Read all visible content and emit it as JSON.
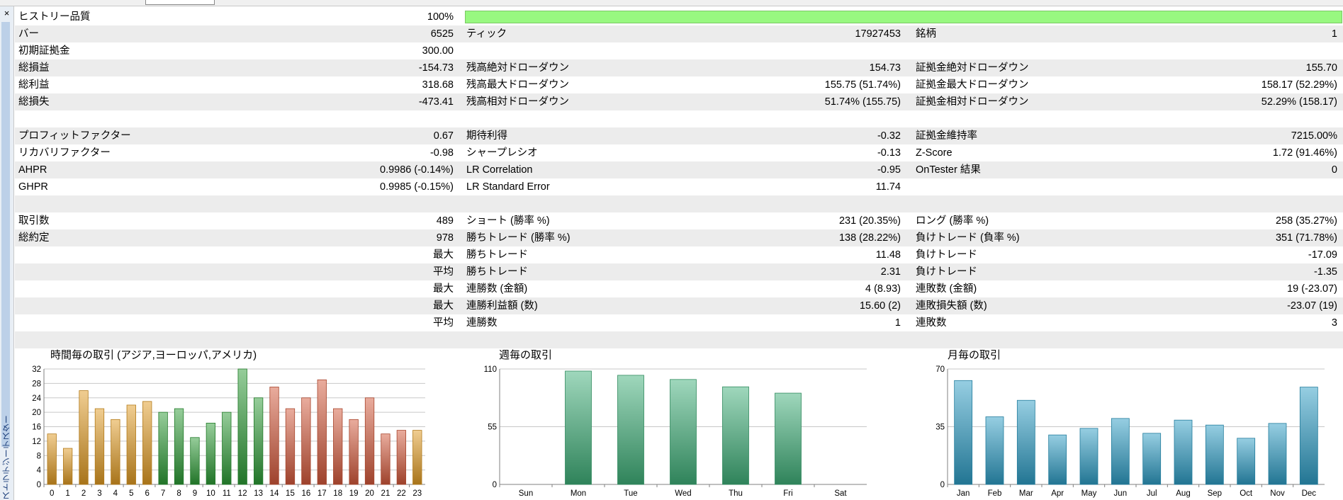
{
  "top_tabs": [
    "",
    "",
    ""
  ],
  "sidebar": {
    "close_glyph": "×",
    "title": "ストラテジーテスター"
  },
  "report": {
    "rows": [
      {
        "l1": "ヒストリー品質",
        "v1": "100%",
        "l2": "",
        "v2": "",
        "l3": "",
        "v3": "",
        "quality_fraction": 1.0,
        "shade": false
      },
      {
        "l1": "バー",
        "v1": "6525",
        "l2": "ティック",
        "v2": "17927453",
        "l3": "銘柄",
        "v3": "1",
        "shade": true
      },
      {
        "l1": "初期証拠金",
        "v1": "300.00",
        "l2": "",
        "v2": "",
        "l3": "",
        "v3": "",
        "shade": false
      },
      {
        "l1": "総損益",
        "v1": "-154.73",
        "l2": "残高絶対ドローダウン",
        "v2": "154.73",
        "l3": "証拠金絶対ドローダウン",
        "v3": "155.70",
        "shade": true
      },
      {
        "l1": "総利益",
        "v1": "318.68",
        "l2": "残高最大ドローダウン",
        "v2": "155.75 (51.74%)",
        "l3": "証拠金最大ドローダウン",
        "v3": "158.17 (52.29%)",
        "shade": false
      },
      {
        "l1": "総損失",
        "v1": "-473.41",
        "l2": "残高相対ドローダウン",
        "v2": "51.74% (155.75)",
        "l3": "証拠金相対ドローダウン",
        "v3": "52.29% (158.17)",
        "shade": true
      },
      {
        "l1": "",
        "v1": "",
        "l2": "",
        "v2": "",
        "l3": "",
        "v3": "",
        "shade": false
      },
      {
        "l1": "プロフィットファクター",
        "v1": "0.67",
        "l2": "期待利得",
        "v2": "-0.32",
        "l3": "証拠金維持率",
        "v3": "7215.00%",
        "shade": true
      },
      {
        "l1": "リカバリファクター",
        "v1": "-0.98",
        "l2": "シャープレシオ",
        "v2": "-0.13",
        "l3": "Z-Score",
        "v3": "1.72 (91.46%)",
        "shade": false
      },
      {
        "l1": "AHPR",
        "v1": "0.9986 (-0.14%)",
        "l2": "LR Correlation",
        "v2": "-0.95",
        "l3": "OnTester 結果",
        "v3": "0",
        "shade": true
      },
      {
        "l1": "GHPR",
        "v1": "0.9985 (-0.15%)",
        "l2": "LR Standard Error",
        "v2": "11.74",
        "l3": "",
        "v3": "",
        "shade": false
      },
      {
        "l1": "",
        "v1": "",
        "l2": "",
        "v2": "",
        "l3": "",
        "v3": "",
        "shade": true
      },
      {
        "l1": "取引数",
        "v1": "489",
        "l2": "ショート (勝率 %)",
        "v2": "231 (20.35%)",
        "l3": "ロング (勝率 %)",
        "v3": "258 (35.27%)",
        "shade": false
      },
      {
        "l1": "総約定",
        "v1": "978",
        "l2": "勝ちトレード (勝率 %)",
        "v2": "138 (28.22%)",
        "l3": "負けトレード (負率 %)",
        "v3": "351 (71.78%)",
        "shade": true
      },
      {
        "l1": "",
        "v1": "最大",
        "l2": "勝ちトレード",
        "v2": "11.48",
        "l3": "負けトレード",
        "v3": "-17.09",
        "shade": false
      },
      {
        "l1": "",
        "v1": "平均",
        "l2": "勝ちトレード",
        "v2": "2.31",
        "l3": "負けトレード",
        "v3": "-1.35",
        "shade": true
      },
      {
        "l1": "",
        "v1": "最大",
        "l2": "連勝数 (金額)",
        "v2": "4 (8.93)",
        "l3": "連敗数 (金額)",
        "v3": "19 (-23.07)",
        "shade": false
      },
      {
        "l1": "",
        "v1": "最大",
        "l2": "連勝利益額 (数)",
        "v2": "15.60 (2)",
        "l3": "連敗損失額 (数)",
        "v3": "-23.07 (19)",
        "shade": true
      },
      {
        "l1": "",
        "v1": "平均",
        "l2": "連勝数",
        "v2": "1",
        "l3": "連敗数",
        "v3": "3",
        "shade": false
      },
      {
        "l1": "",
        "v1": "",
        "l2": "",
        "v2": "",
        "l3": "",
        "v3": "",
        "shade": true
      }
    ]
  },
  "chart_data": [
    {
      "type": "bar",
      "title": "時間毎の取引 (アジア,ヨーロッパ,アメリカ)",
      "categories": [
        "0",
        "1",
        "2",
        "3",
        "4",
        "5",
        "6",
        "7",
        "8",
        "9",
        "10",
        "11",
        "12",
        "13",
        "14",
        "15",
        "16",
        "17",
        "18",
        "19",
        "20",
        "21",
        "22",
        "23"
      ],
      "values": [
        14,
        10,
        26,
        21,
        18,
        22,
        23,
        20,
        21,
        13,
        17,
        20,
        32,
        24,
        27,
        21,
        24,
        29,
        21,
        18,
        24,
        14,
        15,
        15
      ],
      "session_by_category": [
        "asia",
        "asia",
        "asia",
        "asia",
        "asia",
        "asia",
        "asia",
        "europe",
        "europe",
        "europe",
        "europe",
        "europe",
        "europe",
        "europe",
        "america",
        "america",
        "america",
        "america",
        "america",
        "america",
        "america",
        "america",
        "america",
        "asia"
      ],
      "colors": {
        "asia": "#e09a22",
        "europe": "#2c9a35",
        "america": "#d2583a"
      },
      "yticks": [
        0,
        4,
        8,
        12,
        16,
        20,
        24,
        28,
        32
      ],
      "ylim": [
        0,
        32
      ],
      "grid": true
    },
    {
      "type": "bar",
      "title": "週毎の取引",
      "categories": [
        "Sun",
        "Mon",
        "Tue",
        "Wed",
        "Thu",
        "Fri",
        "Sat"
      ],
      "values": [
        0,
        108,
        104,
        100,
        93,
        87,
        0
      ],
      "color": "#3fae78",
      "yticks": [
        0,
        55,
        110
      ],
      "ylim": [
        0,
        110
      ],
      "grid": true
    },
    {
      "type": "bar",
      "title": "月毎の取引",
      "categories": [
        "Jan",
        "Feb",
        "Mar",
        "Apr",
        "May",
        "Jun",
        "Jul",
        "Aug",
        "Sep",
        "Oct",
        "Nov",
        "Dec"
      ],
      "values": [
        63,
        41,
        51,
        30,
        34,
        40,
        31,
        39,
        36,
        28,
        37,
        59
      ],
      "color": "#2d9cc4",
      "yticks": [
        0,
        35,
        70
      ],
      "ylim": [
        0,
        70
      ],
      "grid": true
    }
  ]
}
